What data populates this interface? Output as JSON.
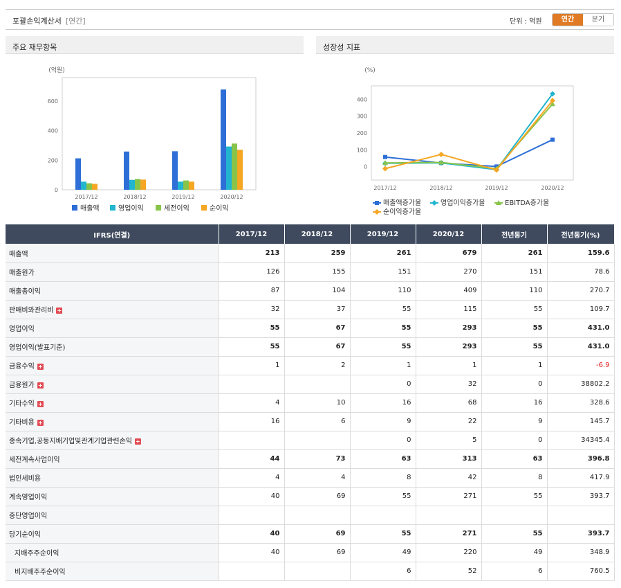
{
  "header": {
    "title": "포괄손익계산서",
    "tag": "[연간]",
    "unit": "단위 : 억원",
    "seg_annual": "연간",
    "seg_quarter": "분기"
  },
  "left_panel": {
    "title": "주요 재무항목"
  },
  "right_panel": {
    "title": "성장성 지표"
  },
  "chart_data": [
    {
      "type": "bar",
      "ylabel": "(억원)",
      "categories": [
        "2017/12",
        "2018/12",
        "2019/12",
        "2020/12"
      ],
      "yticks": [
        0,
        200,
        400,
        600
      ],
      "ylim": [
        0,
        760
      ],
      "series": [
        {
          "name": "매출액",
          "color": "#2d6fd6",
          "values": [
            213,
            259,
            261,
            679
          ]
        },
        {
          "name": "영업이익",
          "color": "#22b5cf",
          "values": [
            55,
            67,
            55,
            293
          ]
        },
        {
          "name": "세전이익",
          "color": "#88c44a",
          "values": [
            44,
            73,
            63,
            313
          ]
        },
        {
          "name": "순이익",
          "color": "#f5a623",
          "values": [
            40,
            69,
            55,
            271
          ]
        }
      ]
    },
    {
      "type": "line",
      "ylabel": "(%)",
      "categories": [
        "2017/12",
        "2018/12",
        "2019/12",
        "2020/12"
      ],
      "yticks": [
        0,
        100,
        200,
        300,
        400
      ],
      "ylim": [
        -80,
        480
      ],
      "series": [
        {
          "name": "매출액증가율",
          "color": "#2d6fd6",
          "marker": "square",
          "values": [
            57,
            21.6,
            0.8,
            160.2
          ]
        },
        {
          "name": "영업이익증가율",
          "color": "#22b5cf",
          "marker": "diamond",
          "values": [
            20,
            21.8,
            -17.9,
            432.7
          ]
        },
        {
          "name": "EBITDA증가율",
          "color": "#88c44a",
          "marker": "triangle",
          "values": [
            22,
            25,
            -12,
            372
          ]
        },
        {
          "name": "순이익증가율",
          "color": "#f5a623",
          "marker": "diamond",
          "values": [
            -12,
            72.5,
            -20.3,
            392.7
          ]
        }
      ]
    }
  ],
  "table": {
    "headers": [
      "IFRS(연결)",
      "2017/12",
      "2018/12",
      "2019/12",
      "2020/12",
      "전년동기",
      "전년동기(%)"
    ],
    "rows": [
      {
        "label": "매출액",
        "bold": true,
        "values": [
          "213",
          "259",
          "261",
          "679",
          "261",
          "159.6"
        ]
      },
      {
        "label": "매출원가",
        "values": [
          "126",
          "155",
          "151",
          "270",
          "151",
          "78.6"
        ]
      },
      {
        "label": "매출총이익",
        "values": [
          "87",
          "104",
          "110",
          "409",
          "110",
          "270.7"
        ]
      },
      {
        "label": "판매비와관리비",
        "plus": true,
        "values": [
          "32",
          "37",
          "55",
          "115",
          "55",
          "109.7"
        ]
      },
      {
        "label": "영업이익",
        "bold": true,
        "values": [
          "55",
          "67",
          "55",
          "293",
          "55",
          "431.0"
        ]
      },
      {
        "label": "영업이익(발표기준)",
        "bold": true,
        "values": [
          "55",
          "67",
          "55",
          "293",
          "55",
          "431.0"
        ]
      },
      {
        "label": "금융수익",
        "plus": true,
        "neg_last": true,
        "values": [
          "1",
          "2",
          "1",
          "1",
          "1",
          "-6.9"
        ]
      },
      {
        "label": "금융원가",
        "plus": true,
        "values": [
          "",
          "",
          "0",
          "32",
          "0",
          "38802.2"
        ]
      },
      {
        "label": "기타수익",
        "plus": true,
        "values": [
          "4",
          "10",
          "16",
          "68",
          "16",
          "328.6"
        ]
      },
      {
        "label": "기타비용",
        "plus": true,
        "values": [
          "16",
          "6",
          "9",
          "22",
          "9",
          "145.7"
        ]
      },
      {
        "label": "종속기업,공동지배기업및관계기업관련손익",
        "plus": true,
        "values": [
          "",
          "",
          "0",
          "5",
          "0",
          "34345.4"
        ]
      },
      {
        "label": "세전계속사업이익",
        "bold": true,
        "values": [
          "44",
          "73",
          "63",
          "313",
          "63",
          "396.8"
        ]
      },
      {
        "label": "법인세비용",
        "values": [
          "4",
          "4",
          "8",
          "42",
          "8",
          "417.9"
        ]
      },
      {
        "label": "계속영업이익",
        "values": [
          "40",
          "69",
          "55",
          "271",
          "55",
          "393.7"
        ]
      },
      {
        "label": "중단영업이익",
        "values": [
          "",
          "",
          "",
          "",
          "",
          ""
        ]
      },
      {
        "label": "당기순이익",
        "bold": true,
        "values": [
          "40",
          "69",
          "55",
          "271",
          "55",
          "393.7"
        ]
      },
      {
        "label": "지배주주순이익",
        "indent": true,
        "values": [
          "40",
          "69",
          "49",
          "220",
          "49",
          "348.9"
        ]
      },
      {
        "label": "비지배주주순이익",
        "indent": true,
        "values": [
          "",
          "",
          "6",
          "52",
          "6",
          "760.5"
        ]
      }
    ]
  }
}
